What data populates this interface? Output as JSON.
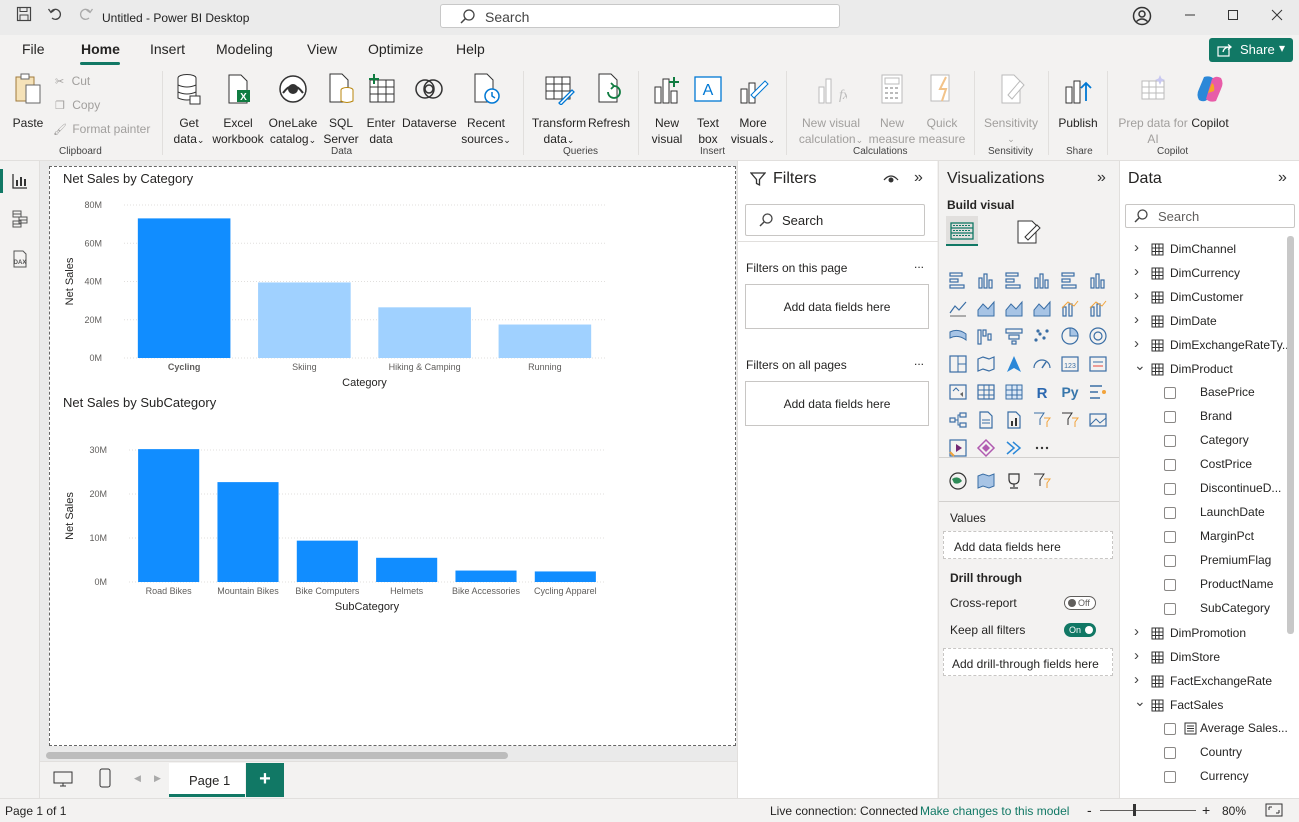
{
  "titlebar": {
    "title": "Untitled - Power BI Desktop",
    "search_label": "Search"
  },
  "menu": {
    "tabs": [
      "File",
      "Home",
      "Insert",
      "Modeling",
      "View",
      "Optimize",
      "Help"
    ],
    "active": "Home",
    "share_label": "Share"
  },
  "ribbon": {
    "clipboard": {
      "paste": "Paste",
      "cut": "Cut",
      "copy": "Copy",
      "format_painter": "Format painter",
      "group": "Clipboard"
    },
    "data": {
      "get_data": [
        "Get",
        "data"
      ],
      "excel": [
        "Excel",
        "workbook"
      ],
      "onelake": [
        "OneLake",
        "catalog"
      ],
      "sql": [
        "SQL",
        "Server"
      ],
      "enter": [
        "Enter",
        "data"
      ],
      "dataverse": "Dataverse",
      "recent": [
        "Recent",
        "sources"
      ],
      "group": "Data"
    },
    "queries": {
      "transform": [
        "Transform",
        "data"
      ],
      "refresh": "Refresh",
      "group": "Queries"
    },
    "insert": {
      "new_visual": [
        "New",
        "visual"
      ],
      "text_box": [
        "Text",
        "box"
      ],
      "more_visuals": [
        "More",
        "visuals"
      ],
      "group": "Insert"
    },
    "calculations": {
      "new_visual_calc": [
        "New visual",
        "calculation"
      ],
      "new_measure": [
        "New",
        "measure"
      ],
      "quick_measure": [
        "Quick",
        "measure"
      ],
      "group": "Calculations"
    },
    "sensitivity": {
      "label": "Sensitivity",
      "group": "Sensitivity"
    },
    "share": {
      "publish": "Publish",
      "group": "Share"
    },
    "copilot": {
      "prep": [
        "Prep data for",
        "AI"
      ],
      "copilot": "Copilot",
      "group": "Copilot"
    }
  },
  "charts": [
    {
      "title": "Net Sales by Category",
      "chart_data": {
        "type": "bar",
        "title": "Net Sales by Category",
        "xlabel": "Category",
        "ylabel": "Net Sales",
        "categories": [
          "Cycling",
          "Skiing",
          "Hiking & Camping",
          "Running"
        ],
        "values": [
          73000000,
          39500000,
          26500000,
          17500000
        ],
        "highlighted": "Cycling",
        "yticks": [
          "0M",
          "20M",
          "40M",
          "60M",
          "80M"
        ],
        "ylim": [
          0,
          80000000
        ],
        "colors": {
          "highlight": "#118DFF",
          "faded": "#A0D1FF"
        }
      }
    },
    {
      "title": "Net Sales by SubCategory",
      "chart_data": {
        "type": "bar",
        "title": "Net Sales by SubCategory",
        "xlabel": "SubCategory",
        "ylabel": "Net Sales",
        "categories": [
          "Road Bikes",
          "Mountain Bikes",
          "Bike Computers",
          "Helmets",
          "Bike Accessories",
          "Cycling Apparel"
        ],
        "values": [
          30200000,
          22700000,
          9400000,
          5500000,
          2600000,
          2400000
        ],
        "yticks": [
          "0M",
          "10M",
          "20M",
          "30M"
        ],
        "ylim": [
          0,
          30000000
        ],
        "colors": {
          "bar": "#118DFF"
        }
      }
    }
  ],
  "page_tabs": {
    "current": "Page 1",
    "add": "+"
  },
  "filters": {
    "title": "Filters",
    "search": "Search",
    "on_this_page": "Filters on this page",
    "on_all_pages": "Filters on all pages",
    "add_fields": "Add data fields here",
    "more": "..."
  },
  "visualizations": {
    "title": "Visualizations",
    "build_visual": "Build visual",
    "values_label": "Values",
    "values_drop": "Add data fields here",
    "drill_through": "Drill through",
    "cross_report": "Cross-report",
    "cross_report_state": "Off",
    "keep_all_filters": "Keep all filters",
    "keep_all_filters_state": "On",
    "drill_drop": "Add drill-through fields here",
    "more": "..."
  },
  "data": {
    "title": "Data",
    "search": "Search",
    "tables": [
      {
        "name": "DimChannel",
        "expanded": false
      },
      {
        "name": "DimCurrency",
        "expanded": false
      },
      {
        "name": "DimCustomer",
        "expanded": false
      },
      {
        "name": "DimDate",
        "expanded": false
      },
      {
        "name": "DimExchangeRateTy...",
        "expanded": false
      },
      {
        "name": "DimProduct",
        "expanded": true,
        "fields": [
          "BasePrice",
          "Brand",
          "Category",
          "CostPrice",
          "DiscontinueD...",
          "LaunchDate",
          "MarginPct",
          "PremiumFlag",
          "ProductName",
          "SubCategory"
        ]
      },
      {
        "name": "DimPromotion",
        "expanded": false
      },
      {
        "name": "DimStore",
        "expanded": false
      },
      {
        "name": "FactExchangeRate",
        "expanded": false
      },
      {
        "name": "FactSales",
        "expanded": true,
        "fields": [
          "Average Sales...",
          "Country",
          "Currency"
        ]
      }
    ]
  },
  "status": {
    "page": "Page 1 of 1",
    "connection": "Live connection: Connected",
    "make_changes": "Make changes to this model",
    "zoom": "80%",
    "zoom_minus": "-",
    "zoom_plus": "+"
  },
  "colors": {
    "accent": "#117865",
    "bar": "#118DFF",
    "bar_faded": "#A0D1FF"
  }
}
